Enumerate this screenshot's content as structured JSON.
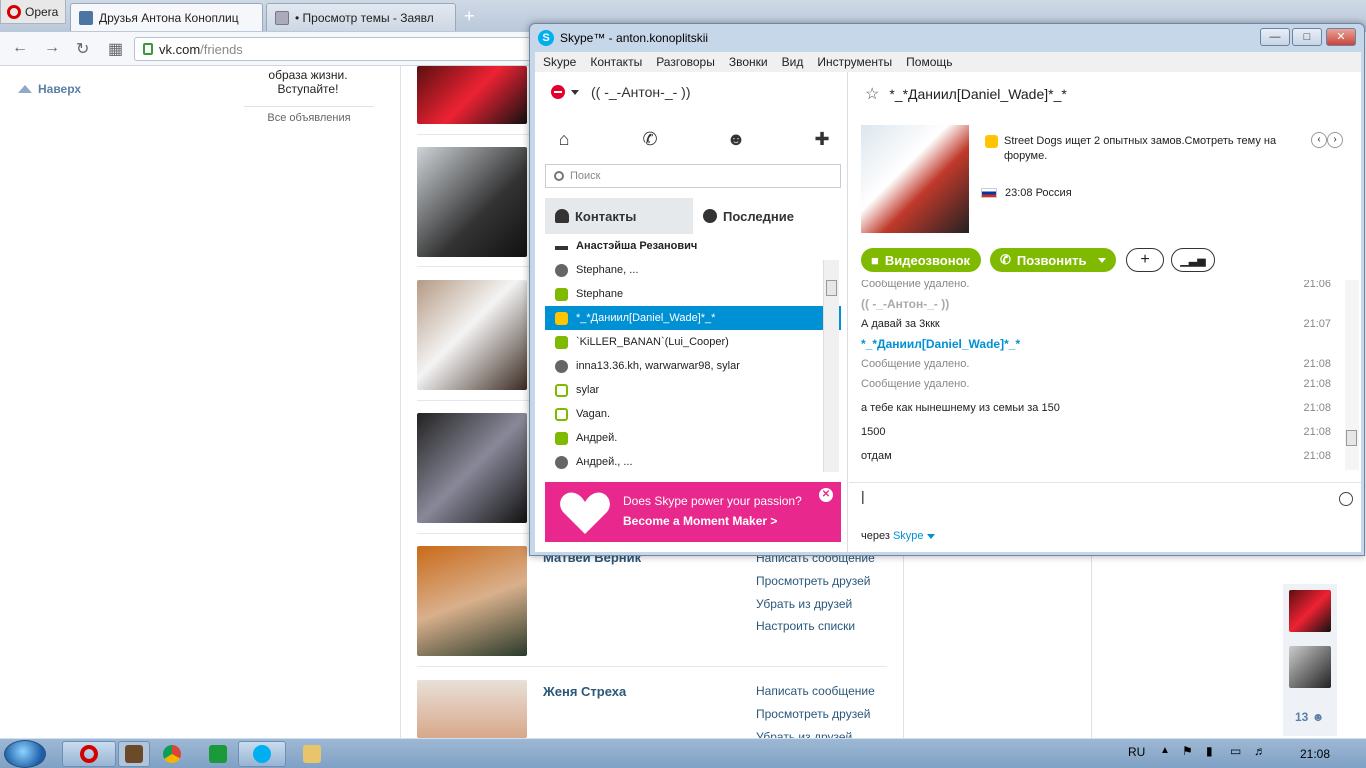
{
  "browser": {
    "menu_label": "Opera",
    "tabs": [
      {
        "label": "Друзья Антона Коноплиц",
        "close": "×"
      },
      {
        "label": "• Просмотр темы - Заявл",
        "close": "×"
      }
    ],
    "new_tab": "+",
    "url_domain": "vk.com",
    "url_path": "/friends"
  },
  "vk": {
    "up_label": "Наверх",
    "ad_text": "образа жизни. Вступайте!",
    "ad_all": "Все объявления",
    "friends": [
      {
        "name": "Матвей Верник",
        "links": [
          "Написать сообщение",
          "Просмотреть друзей",
          "Убрать из друзей",
          "Настроить списки"
        ]
      },
      {
        "name": "Женя Стреха",
        "links": [
          "Написать сообщение",
          "Просмотреть друзей",
          "Убрать из друзей"
        ]
      }
    ],
    "online_count": "13"
  },
  "skype": {
    "title": "Skype™ - anton.konoplitskii",
    "menu": [
      "Skype",
      "Контакты",
      "Разговоры",
      "Звонки",
      "Вид",
      "Инструменты",
      "Помощь"
    ],
    "user": "(( -_-Антон-_- ))",
    "search_placeholder": "Поиск",
    "tab_contacts": "Контакты",
    "tab_recent": "Последние",
    "contacts": [
      {
        "name": "Анастэйша Резанович",
        "status": "phone"
      },
      {
        "name": "Stephane, ...",
        "status": "grp"
      },
      {
        "name": "Stephane",
        "status": "on"
      },
      {
        "name": "*_*Даниил[Daniel_Wade]*_*",
        "status": "away"
      },
      {
        "name": "`KiLLER_BANAN`(Lui_Cooper)",
        "status": "on"
      },
      {
        "name": "inna13.36.kh, warwarwar98, sylar",
        "status": "grp"
      },
      {
        "name": "sylar",
        "status": "off"
      },
      {
        "name": "Vagan.",
        "status": "off"
      },
      {
        "name": "Андрей.",
        "status": "on"
      },
      {
        "name": "Андрей., ...",
        "status": "grp"
      }
    ],
    "banner_line1": "Does Skype power your passion?",
    "banner_line2": "Become a Moment Maker >",
    "conversation": {
      "title": "*_*Даниил[Daniel_Wade]*_*",
      "mood": "Street Dogs ищет 2 опытных замов.Смотреть тему на форуме.",
      "local_time": "23:08 Россия",
      "btn_video": "Видеозвонок",
      "btn_call": "Позвонить",
      "messages": [
        {
          "kind": "del",
          "text": "Сообщение удалено.",
          "time": "21:06"
        },
        {
          "kind": "author",
          "text": "(( -_-Антон-_- ))",
          "time": ""
        },
        {
          "kind": "msg",
          "text": "А давай за 3ккк",
          "time": "21:07"
        },
        {
          "kind": "author2",
          "text": "*_*Даниил[Daniel_Wade]*_*",
          "time": ""
        },
        {
          "kind": "del",
          "text": "Сообщение удалено.",
          "time": "21:08"
        },
        {
          "kind": "del",
          "text": "Сообщение удалено.",
          "time": "21:08"
        },
        {
          "kind": "msg",
          "text": "а тебе как нынешнему из семьи за 150",
          "time": "21:08"
        },
        {
          "kind": "msg",
          "text": "1500",
          "time": "21:08"
        },
        {
          "kind": "msg",
          "text": "отдам",
          "time": "21:08"
        }
      ],
      "via_label": "через",
      "via_service": "Skype"
    }
  },
  "taskbar": {
    "lang": "RU",
    "clock": "21:08"
  }
}
